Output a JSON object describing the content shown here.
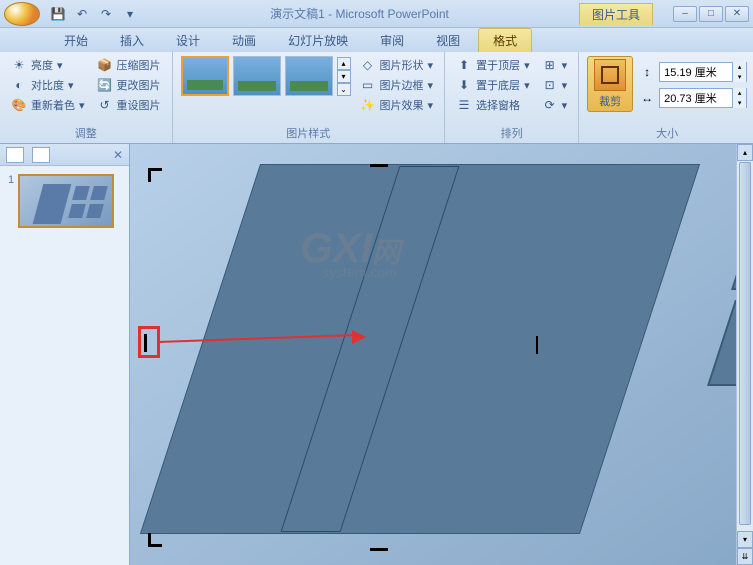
{
  "title": "演示文稿1 - Microsoft PowerPoint",
  "contextual_tab": "图片工具",
  "tabs": [
    "开始",
    "插入",
    "设计",
    "动画",
    "幻灯片放映",
    "审阅",
    "视图",
    "格式"
  ],
  "active_tab": "格式",
  "ribbon": {
    "adjust": {
      "label": "调整",
      "brightness": "亮度",
      "contrast": "对比度",
      "recolor": "重新着色",
      "compress": "压缩图片",
      "change": "更改图片",
      "reset": "重设图片"
    },
    "styles": {
      "label": "图片样式",
      "shape": "图片形状",
      "border": "图片边框",
      "effects": "图片效果"
    },
    "arrange": {
      "label": "排列",
      "front": "置于顶层",
      "back": "置于底层",
      "selection_pane": "选择窗格"
    },
    "size": {
      "label": "大小",
      "crop": "裁剪",
      "height": "15.19 厘米",
      "width": "20.73 厘米"
    }
  },
  "slide_number": "1",
  "watermark": "GXI",
  "watermark_sub": "system.com",
  "watermark_cn": "网"
}
